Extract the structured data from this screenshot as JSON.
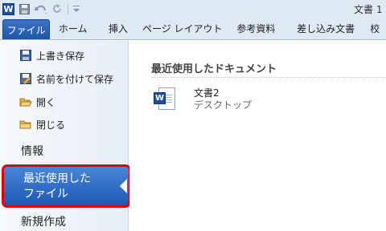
{
  "quick_access": {
    "app_icon": "W",
    "doc_title": "文書 1",
    "icons": [
      "word-icon",
      "save-icon",
      "undo-icon",
      "redo-icon",
      "customize-icon"
    ]
  },
  "ribbon": {
    "tabs": [
      "ファイル",
      "ホーム",
      "挿入",
      "ページ レイアウト",
      "参考資料",
      "差し込み文書",
      "校"
    ]
  },
  "backstage": {
    "commands": [
      {
        "label": "上書き保存",
        "icon": "save-icon"
      },
      {
        "label": "名前を付けて保存",
        "icon": "save-as-icon"
      },
      {
        "label": "開く",
        "icon": "open-folder-icon"
      },
      {
        "label": "閉じる",
        "icon": "close-folder-icon"
      }
    ],
    "info_label": "情報",
    "recent_label": "最近使用した\nファイル",
    "new_label": "新規作成"
  },
  "main": {
    "title": "最近使用したドキュメント",
    "documents": [
      {
        "name": "文書2",
        "location": "デスクトップ"
      }
    ]
  },
  "colors": {
    "selection_border": "#e20000",
    "selection_fill": "#2f6bc4",
    "word_blue": "#1d4f9c"
  }
}
